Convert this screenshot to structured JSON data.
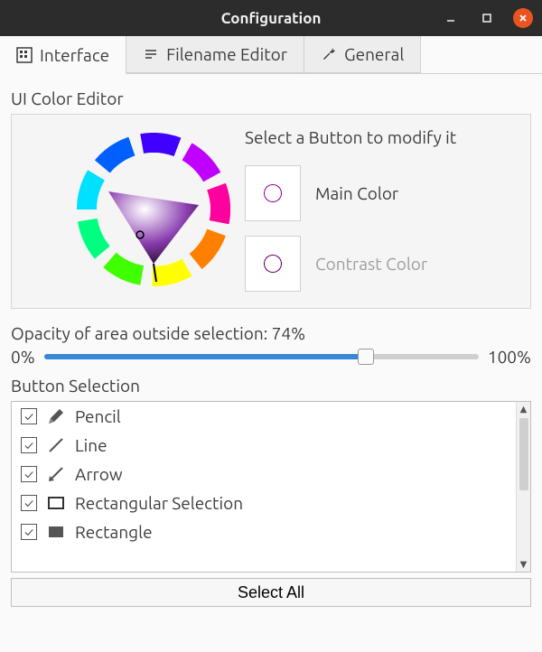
{
  "titlebar": {
    "title": "Configuration"
  },
  "tabs": [
    {
      "label": "Interface",
      "icon": "grid"
    },
    {
      "label": "Filename Editor",
      "icon": "lines"
    },
    {
      "label": "General",
      "icon": "wrench"
    }
  ],
  "color_editor": {
    "title": "UI Color Editor",
    "prompt": "Select a Button to modify it",
    "main": {
      "label": "Main Color",
      "color": "#a000a0"
    },
    "contrast": {
      "label": "Contrast Color",
      "color": "#6a006a"
    }
  },
  "opacity": {
    "label": "Opacity of area outside selection: 74%",
    "min_label": "0%",
    "max_label": "100%",
    "value": 74
  },
  "button_selection": {
    "title": "Button Selection",
    "select_all": "Select All",
    "items": [
      {
        "label": "Pencil",
        "checked": true,
        "icon": "pencil"
      },
      {
        "label": "Line",
        "checked": true,
        "icon": "line"
      },
      {
        "label": "Arrow",
        "checked": true,
        "icon": "arrow"
      },
      {
        "label": "Rectangular Selection",
        "checked": true,
        "icon": "rect-sel"
      },
      {
        "label": "Rectangle",
        "checked": true,
        "icon": "rect"
      }
    ]
  }
}
